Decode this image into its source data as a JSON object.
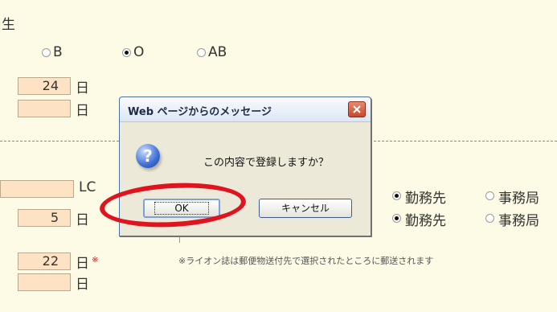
{
  "background": {
    "partial_label": "生",
    "blood_options": [
      {
        "label": "B",
        "checked": false
      },
      {
        "label": "O",
        "checked": true
      },
      {
        "label": "AB",
        "checked": false
      }
    ],
    "day_field_1": {
      "value": "24",
      "unit": "日"
    },
    "day_field_2": {
      "value": "",
      "unit": "日"
    },
    "lc_field": {
      "value": "",
      "unit": "LC"
    },
    "day_field_3": {
      "value": "5",
      "unit": "日"
    },
    "day_field_4": {
      "value": "22",
      "unit": "日",
      "required_mark": "※"
    },
    "day_field_5": {
      "value": "",
      "unit": "日"
    },
    "destination_row_1": {
      "option_a": "勤務先",
      "option_b": "事務局",
      "selected": "option_a"
    },
    "destination_row_2": {
      "option_a": "勤務先",
      "option_b": "事務局",
      "selected": "option_a"
    },
    "notice": "※ライオン誌は郵便物送付先で選択されたところに郵送されます"
  },
  "dialog": {
    "title": "Web ページからのメッセージ",
    "message": "この内容で登録しますか？",
    "ok_label": "OK",
    "cancel_label": "キャンセル",
    "icon": "question-icon"
  },
  "colors": {
    "page_bg": "#fdfbe6",
    "field_bg": "#fde3c4",
    "highlight": "#e0141e"
  }
}
